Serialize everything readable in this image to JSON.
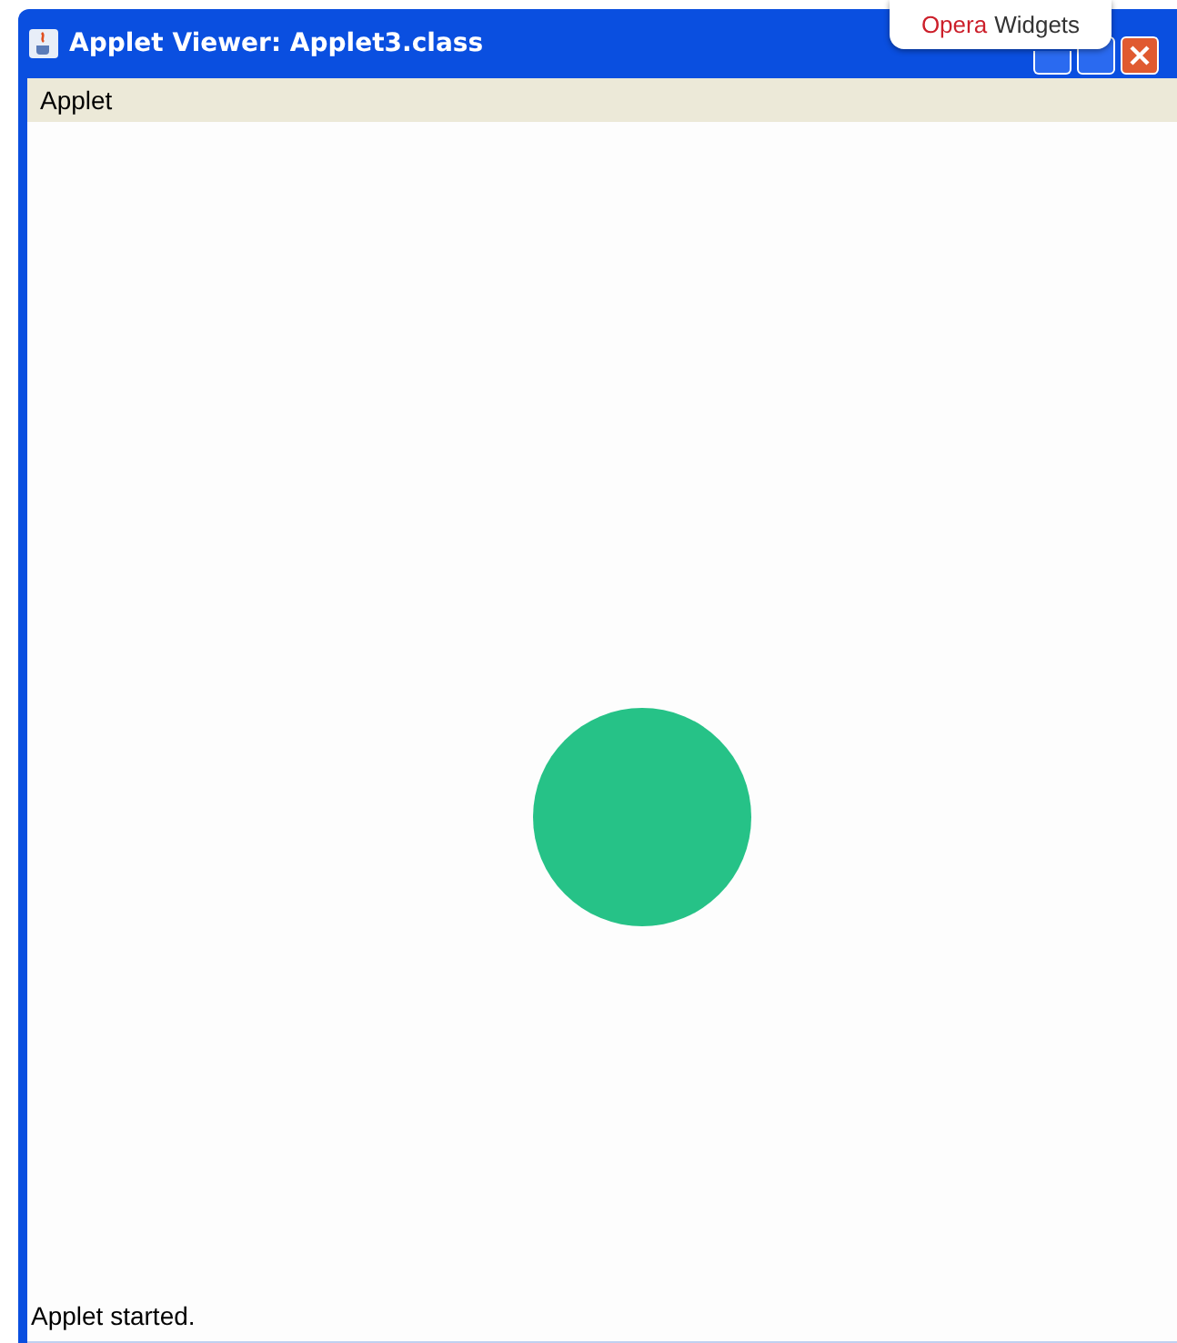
{
  "window": {
    "title": "Applet Viewer: Applet3.class"
  },
  "overlay_tab": {
    "brand": "Opera",
    "label": "Widgets"
  },
  "menu_bar": {
    "items": [
      "Applet"
    ]
  },
  "canvas": {
    "shapes": [
      {
        "kind": "circle",
        "color": "#26c287"
      }
    ]
  },
  "status_bar": {
    "text": "Applet started."
  }
}
